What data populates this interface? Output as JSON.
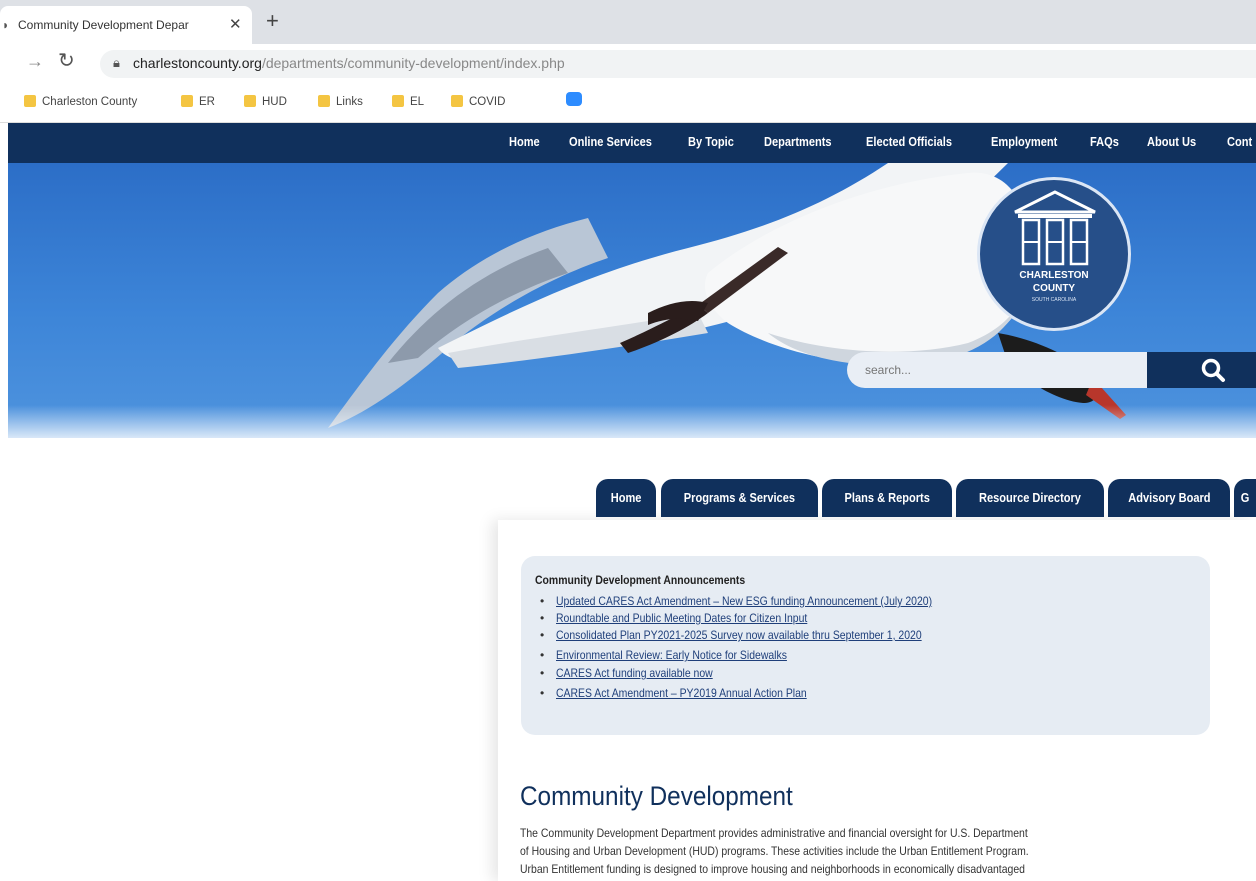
{
  "browser": {
    "tab_title": "Community Development Depar",
    "new_tab_symbol": "+",
    "url_host": "charlestoncounty.org",
    "url_path": "/departments/community-development/index.php",
    "bookmarks": [
      "Charleston County",
      "ER",
      "HUD",
      "Links",
      "EL",
      "COVID"
    ]
  },
  "topnav": {
    "items": [
      "Home",
      "Online Services",
      "By Topic",
      "Departments",
      "Elected Officials",
      "Employment",
      "FAQs",
      "About Us",
      "Cont"
    ]
  },
  "seal": {
    "line1": "CHARLESTON",
    "line2": "COUNTY",
    "line3": "SOUTH CAROLINA"
  },
  "search": {
    "placeholder": "search..."
  },
  "subnav": {
    "tabs": [
      "Home",
      "Programs & Services",
      "Plans & Reports",
      "Resource Directory",
      "Advisory Board",
      "G"
    ]
  },
  "announcements": {
    "title": "Community Development Announcements",
    "items": [
      "Updated CARES Act Amendment – New ESG funding Announcement (July 2020)",
      "Roundtable and Public Meeting Dates for Citizen Input",
      "Consolidated Plan PY2021-2025 Survey now available thru September 1, 2020",
      "Environmental Review: Early Notice for Sidewalks",
      "CARES Act funding available now",
      "CARES Act Amendment – PY2019 Annual Action Plan"
    ]
  },
  "main": {
    "heading": "Community Development",
    "paragraph_lines": [
      "The Community Development Department provides administrative and financial oversight for U.S. Department",
      "of Housing and Urban Development (HUD) programs. These activities include the Urban Entitlement Program.",
      "Urban Entitlement funding is designed to improve housing and neighborhoods in economically disadvantaged"
    ]
  },
  "colors": {
    "navy": "#10305c",
    "sky": "#3d85d8",
    "link": "#1f3f7a",
    "announce_bg": "#e6ecf3"
  }
}
